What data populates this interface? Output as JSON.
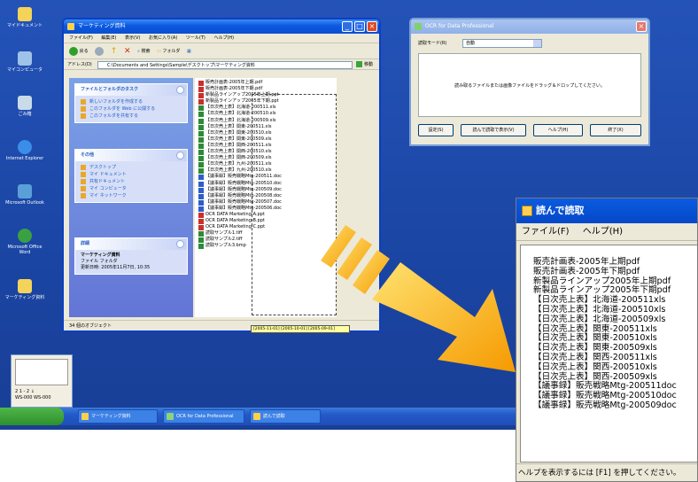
{
  "desktop": {
    "icons": [
      {
        "label": "マイドキュメント"
      },
      {
        "label": "マイコンピュータ"
      },
      {
        "label": "ごみ箱"
      },
      {
        "label": "Internet Explorer"
      },
      {
        "label": "Microsoft Outlook"
      },
      {
        "label": "Microsoft Office Word"
      },
      {
        "label": "マーケティング資料"
      }
    ]
  },
  "taskbar": {
    "items": [
      {
        "label": "マーケティング資料"
      },
      {
        "label": "OCR for Data Professional"
      },
      {
        "label": "読んで読取"
      }
    ]
  },
  "thumbnail": {
    "lines": [
      "2 1 - 2 ↓",
      "WS-000 WS-000"
    ]
  },
  "explorer": {
    "title": "マーケティング資料",
    "menu": [
      "ファイル(F)",
      "編集(E)",
      "表示(V)",
      "お気に入り(A)",
      "ツール(T)",
      "ヘルプ(H)"
    ],
    "toolbar": {
      "back": "戻る",
      "search": "検索",
      "folders": "フォルダ"
    },
    "address_label": "アドレス(D)",
    "address_value": "C:\\Documents and Settings\\Sample\\デスクトップ\\マーケティング資料",
    "go_label": "移動",
    "panels": [
      {
        "title": "ファイルとフォルダのタスク",
        "links": [
          "新しいフォルダを作成する",
          "このフォルダを Web に公開する",
          "このフォルダを共有する"
        ]
      },
      {
        "title": "その他",
        "links": [
          "デスクトップ",
          "マイ ドキュメント",
          "共有ドキュメント",
          "マイ コンピュータ",
          "マイ ネットワーク"
        ]
      },
      {
        "title": "詳細",
        "desc": [
          "マーケティング資料",
          "ファイル フォルダ",
          "更新日時: 2005年11月7日, 10:35"
        ]
      }
    ],
    "files": [
      {
        "name": "販売計画表-2005年上期.pdf",
        "type": "pdf"
      },
      {
        "name": "販売計画表-2005年下期.pdf",
        "type": "pdf"
      },
      {
        "name": "新製品ラインアップ2005年上期.ppt",
        "type": "pdf"
      },
      {
        "name": "新製品ラインアップ2005年下期.ppt",
        "type": "pdf"
      },
      {
        "name": "【日次売上表】北海道-200511.xls",
        "type": "xls"
      },
      {
        "name": "【日次売上表】北海道-200510.xls",
        "type": "xls"
      },
      {
        "name": "【日次売上表】北海道-200509.xls",
        "type": "xls"
      },
      {
        "name": "【日次売上表】関東-200511.xls",
        "type": "xls"
      },
      {
        "name": "【日次売上表】関東-200510.xls",
        "type": "xls"
      },
      {
        "name": "【日次売上表】関東-200509.xls",
        "type": "xls"
      },
      {
        "name": "【日次売上表】関西-200511.xls",
        "type": "xls"
      },
      {
        "name": "【日次売上表】関西-200510.xls",
        "type": "xls"
      },
      {
        "name": "【日次売上表】関西-200509.xls",
        "type": "xls"
      },
      {
        "name": "【日次売上表】九州-200511.xls",
        "type": "xls"
      },
      {
        "name": "【日次売上表】九州-200510.xls",
        "type": "xls"
      },
      {
        "name": "【議事録】販売戦略Mtg-200511.doc",
        "type": "doc"
      },
      {
        "name": "【議事録】販売戦略Mtg-200510.doc",
        "type": "doc"
      },
      {
        "name": "【議事録】販売戦略Mtg-200509.doc",
        "type": "doc"
      },
      {
        "name": "【議事録】販売戦略Mtg-200508.doc",
        "type": "doc"
      },
      {
        "name": "【議事録】販売戦略Mtg-200507.doc",
        "type": "doc"
      },
      {
        "name": "【議事録】販売戦略Mtg-200506.doc",
        "type": "doc"
      },
      {
        "name": "OCR DATA Marketing-A.ppt",
        "type": "pdf"
      },
      {
        "name": "OCR DATA Marketing-B.ppt",
        "type": "pdf"
      },
      {
        "name": "OCR DATA Marketing-C.ppt",
        "type": "pdf"
      },
      {
        "name": "読取サンプル1.tiff",
        "type": "xls"
      },
      {
        "name": "読取サンプル2.tiff",
        "type": "xls"
      },
      {
        "name": "読取サンプル3.bmp",
        "type": "xls"
      }
    ],
    "status": "34 個のオブジェクト",
    "tooltip": "[2005-11-01] [2005-10-01] [2005-09-01]"
  },
  "ocr_window": {
    "title": "OCR for Data Professional",
    "select_label": "読取モード(R)",
    "select_value": "自動",
    "drop_text": "読み取るファイルまたは画像ファイルをドラッグ＆ドロップしてください。",
    "buttons": [
      "設定(S)",
      "読んで読取で表示(V)",
      "ヘルプ(H)",
      "終了(X)"
    ]
  },
  "result_window": {
    "title": "読んで読取",
    "menu": [
      "ファイル(F)",
      "ヘルプ(H)"
    ],
    "lines": [
      "販売計画表-2005年上期pdf",
      "販売計画表-2005年下期pdf",
      "新製品ラインアップ2005年上期pdf",
      "新製品ラインアップ2005年下期pdf",
      "【日次売上表】北海道-200511xls",
      "【日次売上表】北海道-200510xls",
      "【日次売上表】北海道-200509xls",
      "【日次売上表】関東-200511xls",
      "【日次売上表】関東-200510xls",
      "【日次売上表】関東-200509xls",
      "【日次売上表】関西-200511xls",
      "【日次売上表】関西-200510xls",
      "【日次売上表】関西-200509xls",
      "【議事録】販売戦略Mtg-200511doc",
      "【議事録】販売戦略Mtg-200510doc",
      "【議事録】販売戦略Mtg-200509doc"
    ],
    "status": "ヘルプを表示するには [F1] を押してください。"
  },
  "colors": {
    "desktop": "#1d48a8",
    "title_active": "#0a4fd2",
    "arrow_light": "#ffd54a",
    "arrow_dark": "#f7a400"
  }
}
